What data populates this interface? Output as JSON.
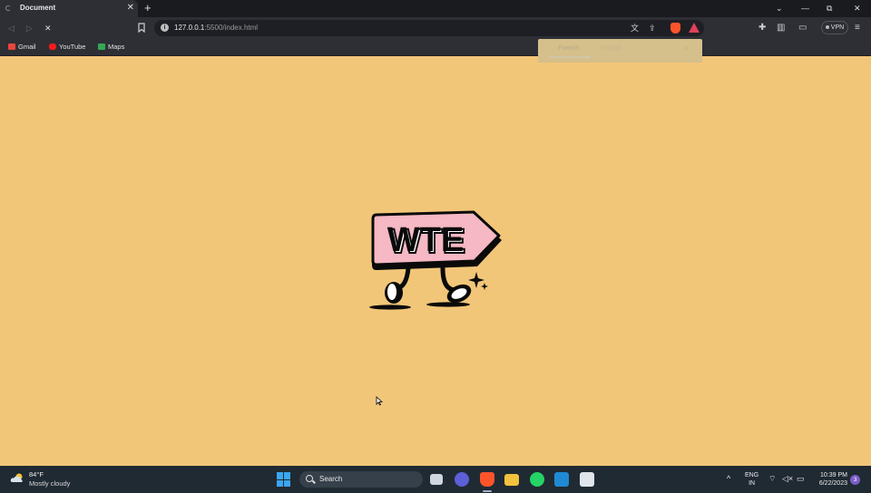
{
  "browser": {
    "tab": {
      "title": "Document",
      "close": "✕"
    },
    "new_tab": "+",
    "window_controls": {
      "list": "⌄",
      "minimize": "—",
      "maximize": "⧉",
      "close": "✕"
    },
    "nav": {
      "back": "◁",
      "forward": "▷",
      "stop": "✕"
    },
    "address": {
      "host": "127.0.0.1",
      "rest": ":5500/index.html",
      "info": "i"
    },
    "vpn_label": "VPN",
    "bookmarks": [
      {
        "label": "Gmail",
        "color": "#e8453c"
      },
      {
        "label": "YouTube",
        "color": "#ff1a1a"
      },
      {
        "label": "Maps",
        "color": "#34a853"
      }
    ]
  },
  "translate_popup": {
    "source": "French",
    "target": "English",
    "menu": "⋮",
    "close": "✕"
  },
  "page": {
    "background": "#f2c679",
    "logo_text": "WTE",
    "logo_colors": {
      "sign": "#f5b8c4",
      "ink": "#0a0a0a"
    }
  },
  "taskbar": {
    "weather": {
      "temp": "84°F",
      "desc": "Mostly cloudy"
    },
    "search_label": "Search",
    "tray": {
      "chevron": "^",
      "lang_top": "ENG",
      "lang_bottom": "IN",
      "time": "10:39 PM",
      "date": "6/22/2023",
      "notifications": "3"
    }
  }
}
